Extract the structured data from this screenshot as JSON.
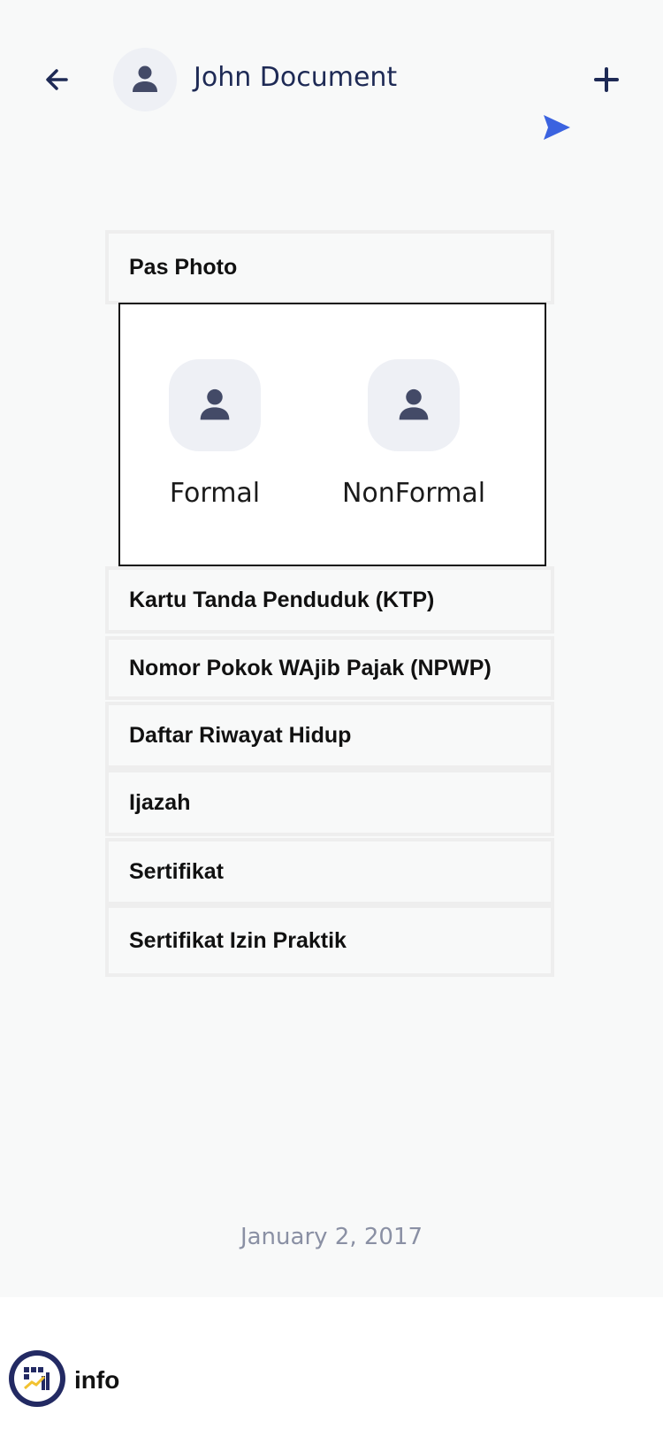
{
  "header": {
    "title": "John Document",
    "back_icon": "arrow-left-icon",
    "add_icon": "plus-icon",
    "send_icon": "send-icon",
    "accent_color": "#3b63e0",
    "text_color": "#1e2a55"
  },
  "documents": [
    {
      "label": "Pas Photo"
    },
    {
      "label": "Kartu Tanda Penduduk (KTP)"
    },
    {
      "label": "Nomor Pokok WAjib Pajak (NPWP)"
    },
    {
      "label": "Daftar Riwayat Hidup"
    },
    {
      "label": "Ijazah"
    },
    {
      "label": "Sertifikat"
    },
    {
      "label": "Sertifikat Izin Praktik"
    }
  ],
  "photo_panel": {
    "options": [
      {
        "label": "Formal",
        "icon": "person-icon"
      },
      {
        "label": "NonFormal",
        "icon": "person-icon"
      }
    ]
  },
  "date": "January 2, 2017",
  "footer": {
    "label": "info",
    "logo_icon": "app-logo-icon",
    "logo_color": "#232a63"
  }
}
